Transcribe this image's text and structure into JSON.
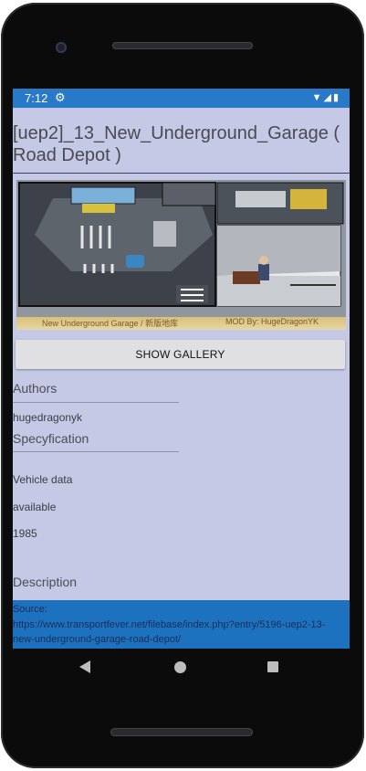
{
  "status": {
    "time": "7:12",
    "settings_icon": "gear-icon",
    "wifi_icon": "wifi-icon",
    "signal_icon": "signal-icon",
    "battery_icon": "battery-icon"
  },
  "page": {
    "title": "[uep2]_13_New_Underground_Garage ( Road Depot )",
    "hero_caption_left": "New Underground Garage / 新版地库",
    "hero_caption_right": "MOD By: HugeDragonYK",
    "gallery_button": "SHOW GALLERY"
  },
  "authors": {
    "label": "Authors",
    "value": "hugedragonyk"
  },
  "specification": {
    "label": "Specyfication",
    "line1": "Vehicle data",
    "line2": "available",
    "line3": "1985"
  },
  "description": {
    "label": "Description",
    "source_label": "Source:",
    "source_url": "https://www.transportfever.net/filebase/index.php?entry/5196-uep2-13-new-underground-garage-road-depot/"
  },
  "nav": {
    "back_icon": "back-triangle-icon",
    "home_icon": "home-circle-icon",
    "recents_icon": "recents-square-icon"
  },
  "colors": {
    "statusbar": "#2979c9",
    "screen_bg": "#c5c9e6",
    "source_bg": "#1d72c0"
  }
}
